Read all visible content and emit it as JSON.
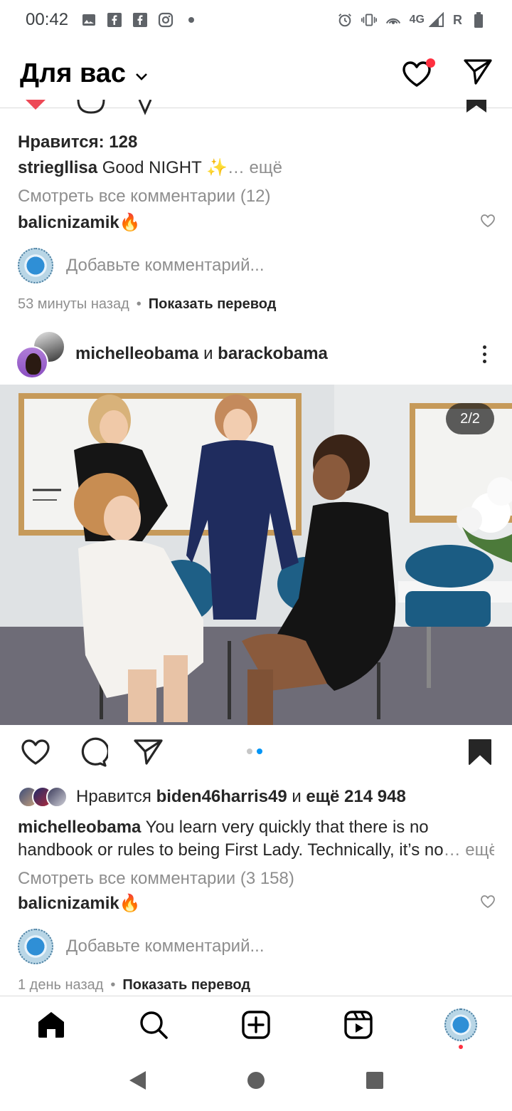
{
  "status_bar": {
    "time": "00:42",
    "network": "4G",
    "roaming": "R"
  },
  "header": {
    "title": "Для вас"
  },
  "post1": {
    "likes": "Нравится: 128",
    "caption_user": "striegllisa",
    "caption_text": " Good NIGHT ✨",
    "caption_more": "… ещё",
    "view_comments": "Смотреть все комментарии (12)",
    "comment_user": "balicnizamik",
    "comment_text": " 🔥",
    "add_comment_placeholder": "Добавьте комментарий...",
    "time_ago": "53 минуты назад",
    "show_translation": "Показать перевод"
  },
  "post2": {
    "user1": "michelleobama",
    "connector": " и ",
    "user2": "barackobama",
    "carousel_counter": "2/2",
    "carousel_current_index": 2,
    "carousel_total": 2,
    "liked_by_prefix": "Нравится ",
    "liked_by_user": "biden46harris49",
    "liked_by_and": " и ",
    "liked_by_count": "ещё 214 948",
    "caption_user": "michelleobama",
    "caption_line1": " You learn very quickly that there is no",
    "caption_line2": "handbook or rules to being First Lady. Technically, it’s no",
    "caption_more": "… ещё",
    "view_comments": "Смотреть все комментарии (3 158)",
    "comment_user": "balicnizamik",
    "comment_text": " 🔥",
    "add_comment_placeholder": "Добавьте комментарий...",
    "time_ago": "1 день назад",
    "show_translation": "Показать перевод"
  },
  "colors": {
    "accent_blue": "#0095f6",
    "notification_red": "#ff3040",
    "secondary_text": "#8e8e8e"
  }
}
